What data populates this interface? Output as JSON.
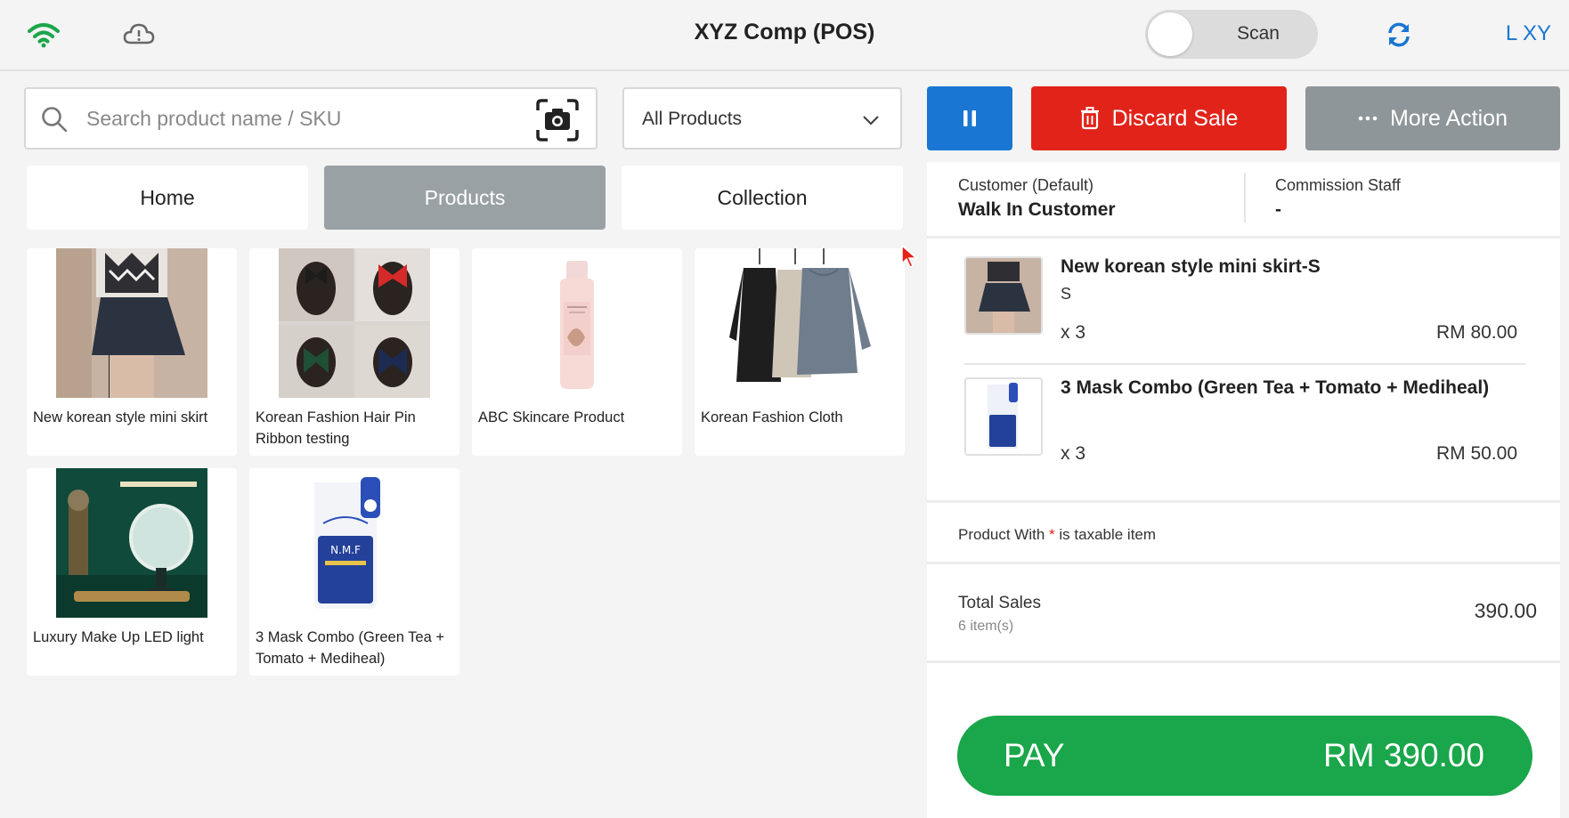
{
  "header": {
    "title": "XYZ Comp (POS)",
    "scan_label": "Scan",
    "user_label": "L XY",
    "colors": {
      "wifi": "#1aa64a",
      "accent": "#1976d2"
    }
  },
  "search": {
    "placeholder": "Search product name / SKU",
    "value": ""
  },
  "filter": {
    "selected": "All Products"
  },
  "tabs": [
    {
      "label": "Home",
      "active": false
    },
    {
      "label": "Products",
      "active": true
    },
    {
      "label": "Collection",
      "active": false
    }
  ],
  "products": [
    {
      "name": "New korean style mini skirt",
      "icon": "skirt-photo"
    },
    {
      "name": "Korean Fashion Hair Pin Ribbon testing",
      "icon": "hair-ribbon-photo"
    },
    {
      "name": "ABC Skincare Product",
      "icon": "skincare-bottle-photo"
    },
    {
      "name": "Korean Fashion Cloth",
      "icon": "sweaters-photo"
    },
    {
      "name": "Luxury Make Up LED light",
      "icon": "led-mirror-photo"
    },
    {
      "name": "3 Mask Combo (Green Tea + Tomato + Mediheal)",
      "icon": "face-mask-photo"
    }
  ],
  "actions": {
    "discard_label": "Discard Sale",
    "more_label": "More Action"
  },
  "customer": {
    "label": "Customer  (Default)",
    "value": "Walk In Customer",
    "staff_label": "Commission Staff",
    "staff_value": "-"
  },
  "cart": [
    {
      "name": "New korean style mini skirt-S",
      "variant": "S",
      "qty": "x 3",
      "price": "RM 80.00"
    },
    {
      "name": "3 Mask Combo (Green Tea + Tomato + Mediheal)",
      "variant": "",
      "qty": "x 3",
      "price": "RM 50.00"
    }
  ],
  "tax_note": {
    "prefix": "Product With ",
    "star": "*",
    "suffix": " is taxable item"
  },
  "totals": {
    "label": "Total Sales",
    "count": "6 item(s)",
    "value": "390.00"
  },
  "pay": {
    "label": "PAY",
    "amount": "RM 390.00",
    "color": "#1aa64a"
  },
  "discard_color": "#e2231a"
}
